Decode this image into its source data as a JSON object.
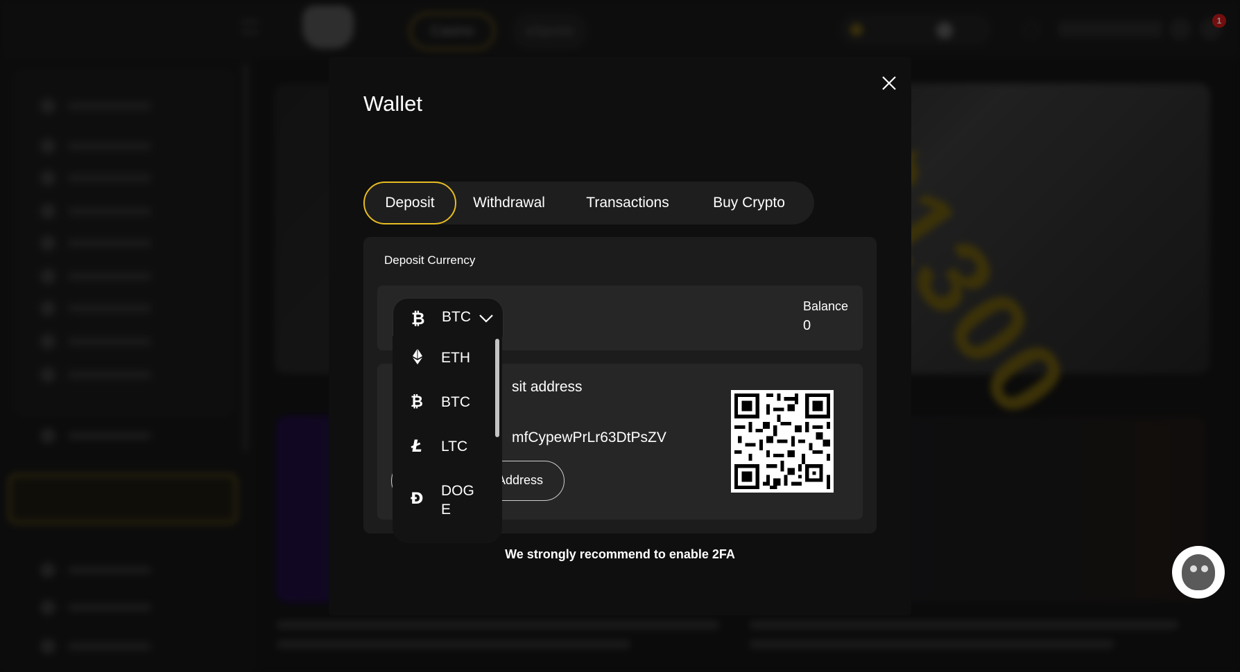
{
  "background": {
    "nav": {
      "casino_label": "Casino",
      "esports_label": "eSports"
    },
    "banner_text": "$1300"
  },
  "notifications": {
    "count": "1"
  },
  "wallet": {
    "title": "Wallet",
    "tabs": [
      {
        "label": "Deposit",
        "active": true
      },
      {
        "label": "Withdrawal",
        "active": false
      },
      {
        "label": "Transactions",
        "active": false
      },
      {
        "label": "Buy Crypto",
        "active": false
      }
    ],
    "deposit": {
      "currency_label": "Deposit Currency",
      "selected_currency": "BTC",
      "balance_label": "Balance",
      "balance_value": "0",
      "address_label_visible": "sit address",
      "address_visible": "mfCypewPrLr63DtPsZV",
      "copy_button_visible": "Address",
      "dropdown_options": [
        "ETH",
        "BTC",
        "LTC",
        "DOG E"
      ]
    },
    "tfa_note": "We strongly recommend to enable 2FA"
  },
  "icons": {
    "close": "close-icon",
    "btc": "bitcoin-icon",
    "eth": "ethereum-icon",
    "ltc": "litecoin-icon",
    "doge": "dogecoin-icon",
    "chevron": "chevron-down-icon",
    "support": "support-avatar-icon"
  },
  "colors": {
    "accent": "#e9bd22",
    "modal_bg": "#0f0f0f",
    "card_bg": "#1c1c1c"
  }
}
